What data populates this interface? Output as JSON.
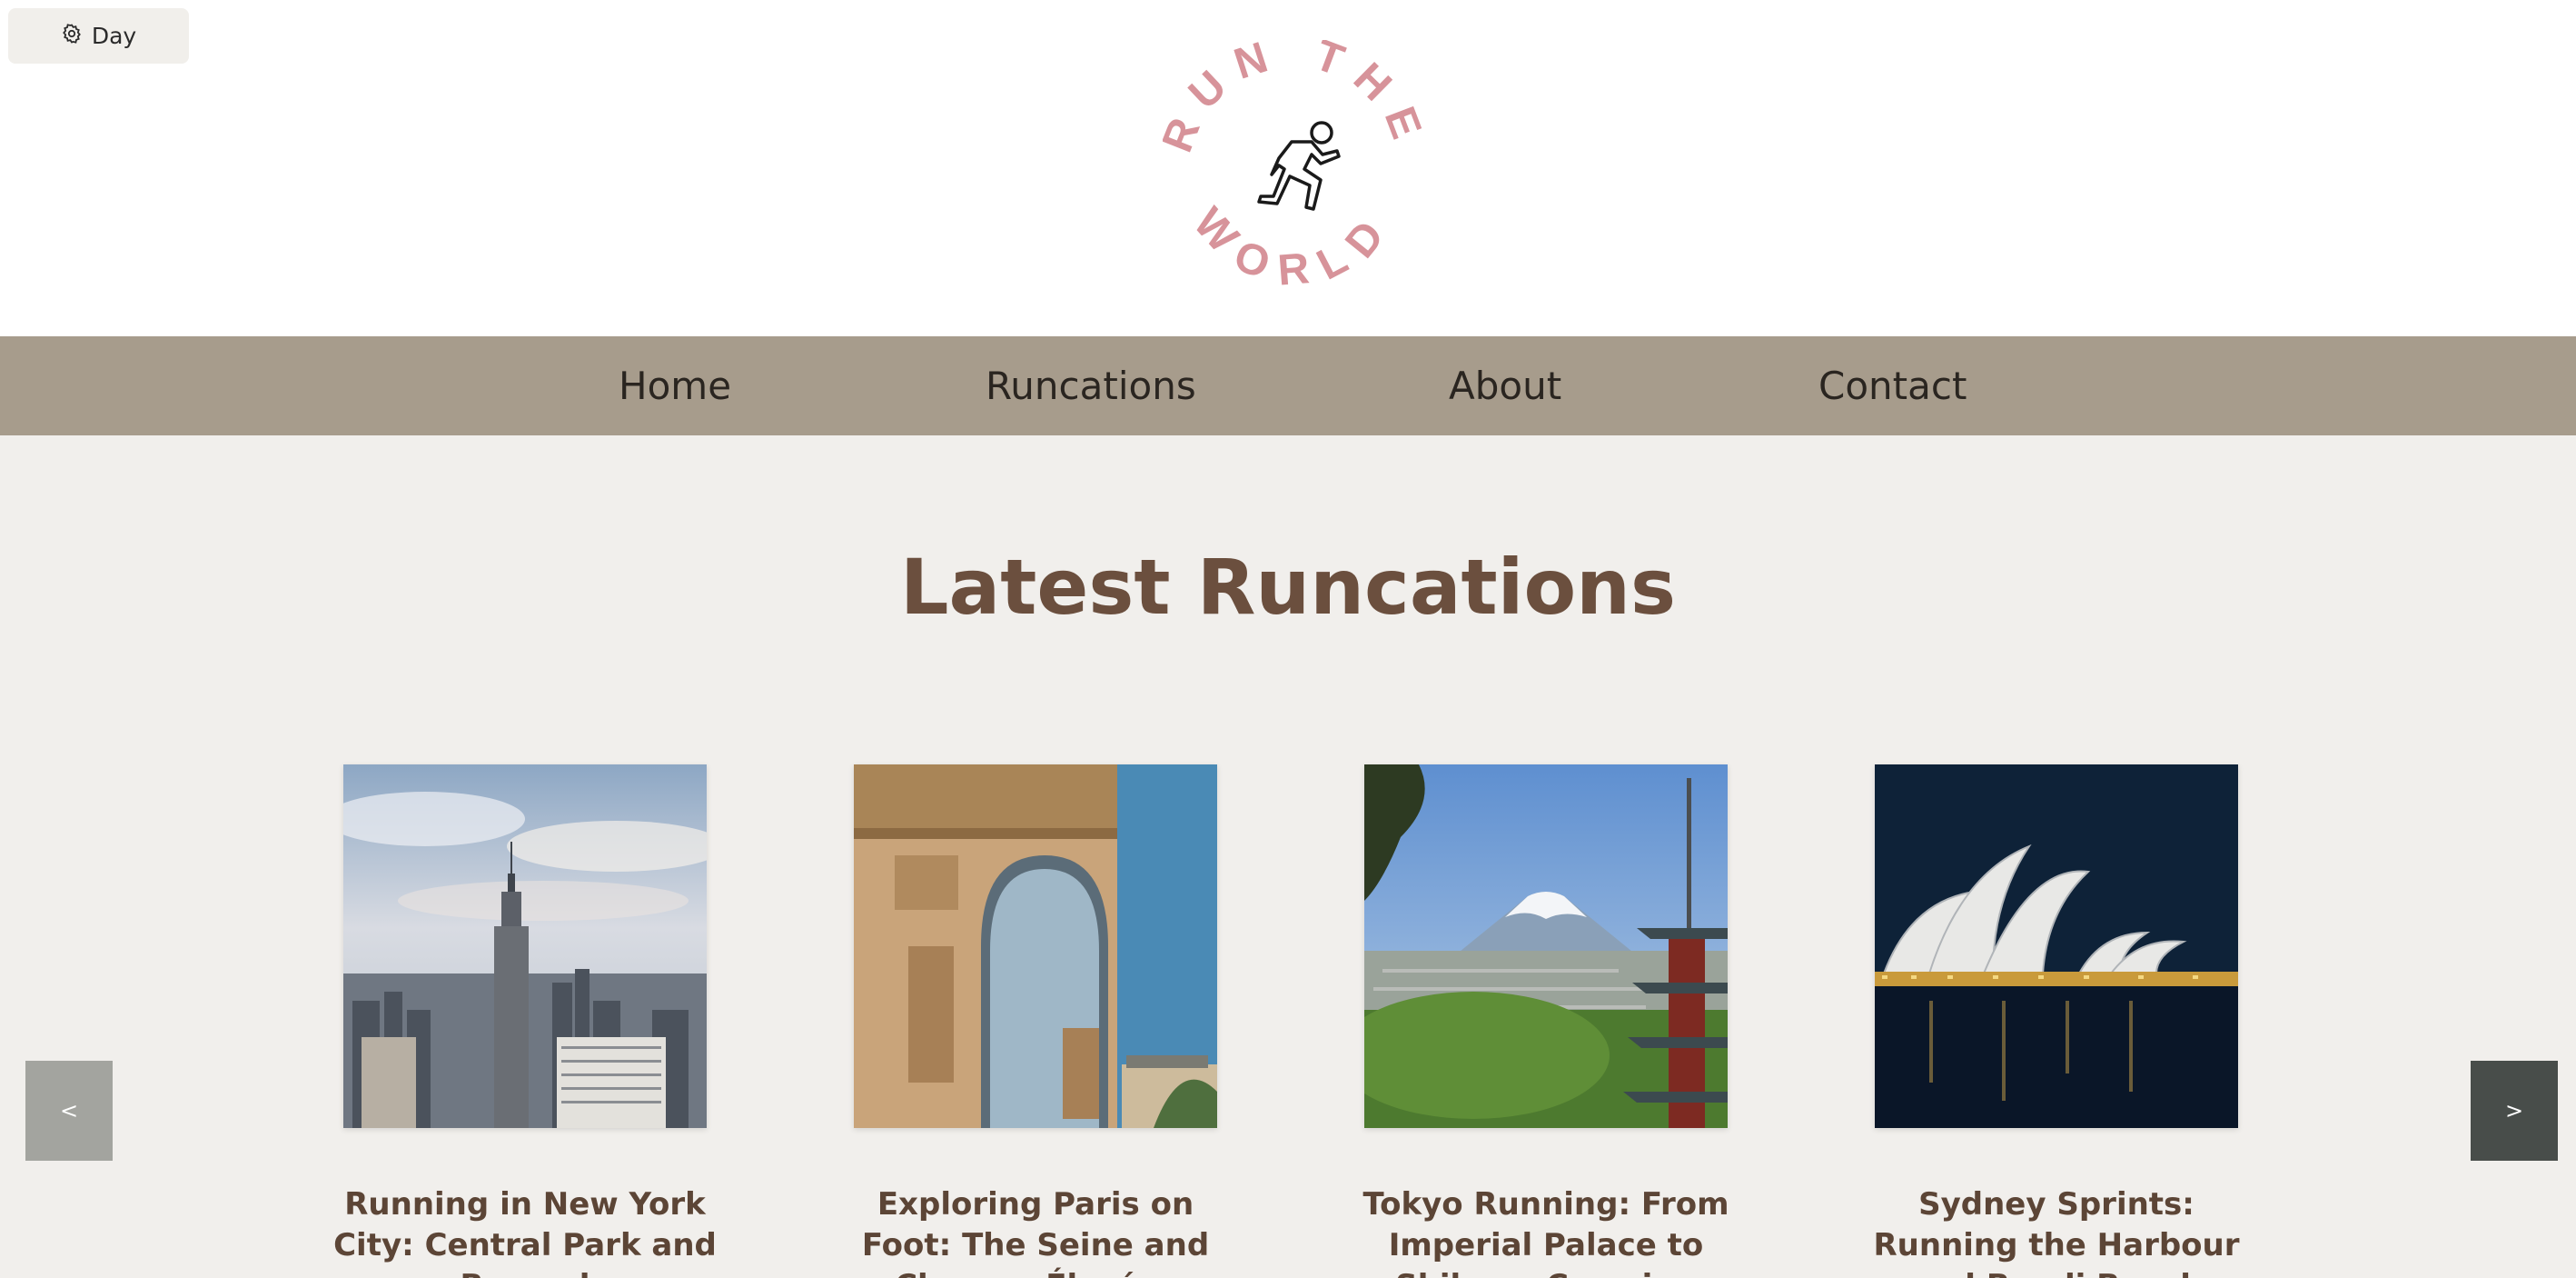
{
  "theme_toggle": {
    "label": "Day",
    "icon": "gear-icon"
  },
  "logo": {
    "top_text": "RUN THE",
    "bottom_text": "WORLD",
    "icon": "runner-icon",
    "color": "#d7939a"
  },
  "nav": {
    "items": [
      {
        "label": "Home"
      },
      {
        "label": "Runcations"
      },
      {
        "label": "About"
      },
      {
        "label": "Contact"
      }
    ],
    "background": "#a79c8c"
  },
  "main": {
    "title": "Latest Runcations",
    "cards": [
      {
        "title": "Running in New York City: Central Park and Beyond",
        "image": "new-york-skyline"
      },
      {
        "title": "Exploring Paris on Foot: The Seine and Champs-Élysées",
        "image": "arc-de-triomphe"
      },
      {
        "title": "Tokyo Running: From Imperial Palace to Shibuya Crossing",
        "image": "mount-fuji-pagoda"
      },
      {
        "title": "Sydney Sprints: Running the Harbour and Bondi Beach",
        "image": "sydney-opera-house"
      }
    ],
    "prev_label": "<",
    "next_label": ">"
  },
  "colors": {
    "accent_title": "#6b4f3e",
    "prev_button": "#a3a49f",
    "next_button": "#484d4a"
  }
}
